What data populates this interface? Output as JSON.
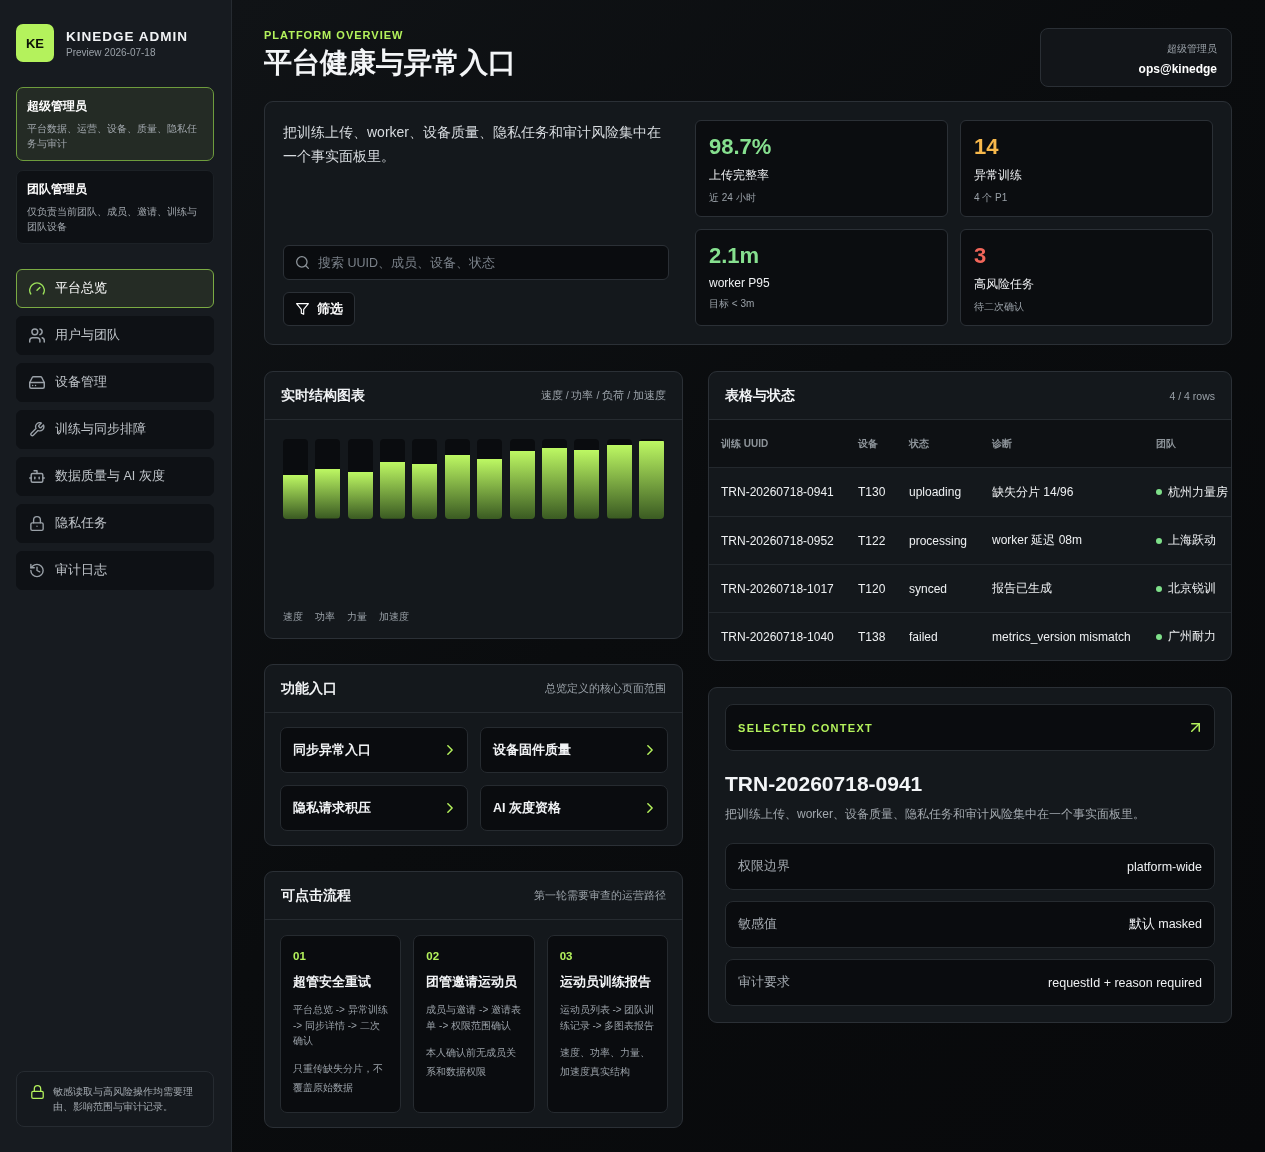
{
  "sidebar": {
    "logo": {
      "mark": "KE",
      "title": "KINEDGE ADMIN",
      "subtitle": "Preview 2026-07-18"
    },
    "roles": [
      {
        "title": "超级管理员",
        "description": "平台数据、运营、设备、质量、隐私任务与审计",
        "selected": true
      },
      {
        "title": "团队管理员",
        "description": "仅负责当前团队、成员、邀请、训练与团队设备",
        "selected": false
      }
    ],
    "nav": [
      {
        "label": "平台总览",
        "selected": true
      },
      {
        "label": "用户与团队",
        "selected": false
      },
      {
        "label": "设备管理",
        "selected": false
      },
      {
        "label": "训练与同步排障",
        "selected": false
      },
      {
        "label": "数据质量与 AI 灰度",
        "selected": false
      },
      {
        "label": "隐私任务",
        "selected": false
      },
      {
        "label": "审计日志",
        "selected": false
      }
    ],
    "notice": "敏感读取与高风险操作均需要理由、影响范围与审计记录。"
  },
  "header": {
    "eyebrow": "PLATFORM OVERVIEW",
    "title": "平台健康与异常入口",
    "account": {
      "role": "超级管理员",
      "email": "ops@kinedge"
    }
  },
  "overview": {
    "summary": "把训练上传、worker、设备质量、隐私任务和审计风险集中在一个事实面板里。",
    "search": {
      "placeholder": "搜索 UUID、成员、设备、状态"
    },
    "filter_button": "筛选",
    "metrics": [
      {
        "value": "98.7%",
        "label": "上传完整率",
        "note": "近 24 小时",
        "color": "#86e08f"
      },
      {
        "value": "14",
        "label": "异常训练",
        "note": "4 个 P1",
        "color": "#f7b84b"
      },
      {
        "value": "2.1m",
        "label": "worker P95",
        "note": "目标 < 3m",
        "color": "#86e08f"
      },
      {
        "value": "3",
        "label": "高风险任务",
        "note": "待二次确认",
        "color": "#f2665a"
      }
    ]
  },
  "chart_panel": {
    "title": "实时结构图表",
    "subtitle": "速度 / 功率 / 负荷 / 加速度",
    "legend": [
      "速度",
      "功率",
      "力量",
      "加速度"
    ]
  },
  "table": {
    "title": "表格与状态",
    "count": "4 / 4 rows",
    "columns": [
      "训练 UUID",
      "设备",
      "状态",
      "诊断",
      "团队"
    ],
    "rows": [
      {
        "id": "TRN-20260718-0941",
        "device": "T130",
        "status": "uploading",
        "diagnosis": "缺失分片 14/96",
        "team": "杭州力量房"
      },
      {
        "id": "TRN-20260718-0952",
        "device": "T122",
        "status": "processing",
        "diagnosis": "worker 延迟 08m",
        "team": "上海跃动"
      },
      {
        "id": "TRN-20260718-1017",
        "device": "T120",
        "status": "synced",
        "diagnosis": "报告已生成",
        "team": "北京锐训"
      },
      {
        "id": "TRN-20260718-1040",
        "device": "T138",
        "status": "failed",
        "diagnosis": "metrics_version mismatch",
        "team": "广州耐力"
      }
    ]
  },
  "entries": {
    "title": "功能入口",
    "subtitle": "总览定义的核心页面范围",
    "items": [
      "同步异常入口",
      "设备固件质量",
      "隐私请求积压",
      "AI 灰度资格"
    ]
  },
  "flows": {
    "title": "可点击流程",
    "subtitle": "第一轮需要审查的运营路径",
    "items": [
      {
        "step": "01",
        "title": "超管安全重试",
        "path": "平台总览 -> 异常训练 -> 同步详情 -> 二次确认",
        "note": "只重传缺失分片，不覆盖原始数据"
      },
      {
        "step": "02",
        "title": "团管邀请运动员",
        "path": "成员与邀请 -> 邀请表单 -> 权限范围确认",
        "note": "本人确认前无成员关系和数据权限"
      },
      {
        "step": "03",
        "title": "运动员训练报告",
        "path": "运动员列表 -> 团队训练记录 -> 多图表报告",
        "note": "速度、功率、力量、加速度真实结构"
      }
    ]
  },
  "context": {
    "eyebrow": "SELECTED CONTEXT",
    "title": "TRN-20260718-0941",
    "description": "把训练上传、worker、设备质量、隐私任务和审计风险集中在一个事实面板里。",
    "fields": [
      {
        "label": "权限边界",
        "value": "platform-wide"
      },
      {
        "label": "敏感值",
        "value": "默认 masked"
      },
      {
        "label": "审计要求",
        "value": "requestId + reason required"
      }
    ]
  }
}
